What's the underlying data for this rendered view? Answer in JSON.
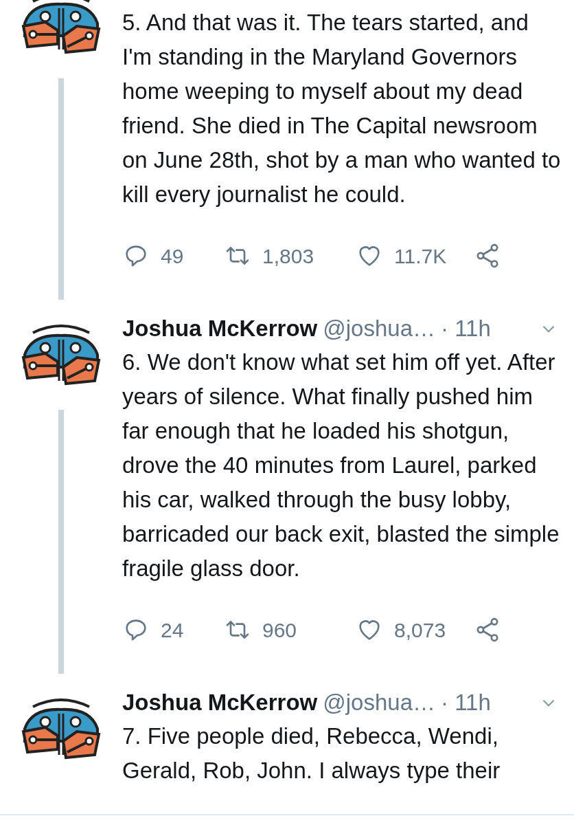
{
  "tweets": [
    {
      "text": "5. And that was it. The tears started, and I'm standing in the Maryland Governors home weeping to myself about my dead friend. She died in The Capital newsroom on June 28th, shot by a man who wanted to kill every journalist he could.",
      "replies": "49",
      "retweets": "1,803",
      "likes": "11.7K"
    },
    {
      "name": "Joshua McKerrow",
      "handle": "@joshua…",
      "time": "· 11h",
      "text": "6. We don't know what set him off yet. After years of silence. What finally pushed him far enough that he loaded his shotgun, drove the 40 minutes from Laurel, parked his car, walked through the busy lobby, barricaded our back exit, blasted the simple fragile glass door.",
      "replies": "24",
      "retweets": "960",
      "likes": "8,073"
    },
    {
      "name": "Joshua McKerrow",
      "handle": "@joshua…",
      "time": "· 11h",
      "text": "7. Five people died, Rebecca, Wendi, Gerald, Rob, John. I always type their"
    }
  ]
}
